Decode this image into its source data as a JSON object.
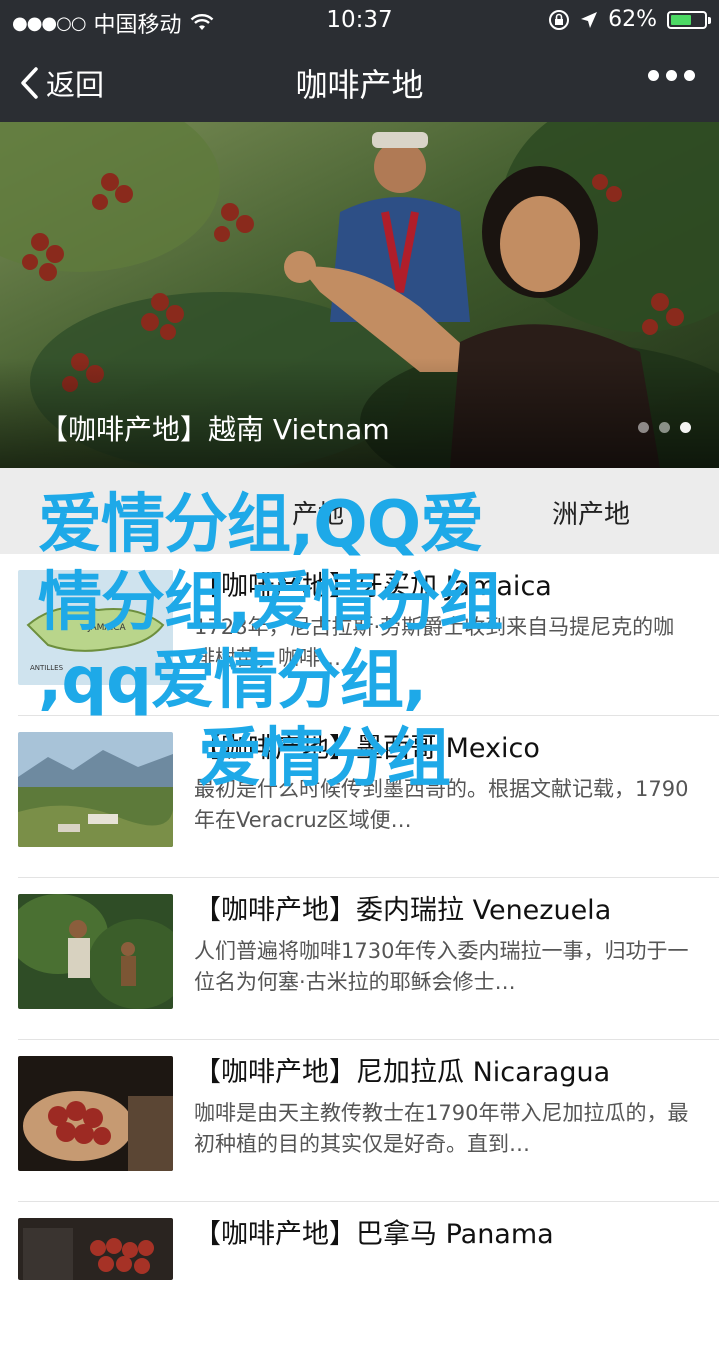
{
  "status_bar": {
    "carrier": "中国移动",
    "signal": "●●●○○",
    "time": "10:37",
    "battery": "62%",
    "battery_level": 0.62,
    "icons": [
      "wifi-icon",
      "lock-rotation-icon",
      "location-arrow-icon",
      "battery-icon"
    ]
  },
  "nav": {
    "back_label": "返回",
    "title": "咖啡产地"
  },
  "hero": {
    "caption": "【咖啡产地】越南 Vietnam",
    "slides": 3,
    "active_slide": 3
  },
  "partial_row": {
    "text_left": "产地",
    "text_right": "洲产地"
  },
  "items": [
    {
      "title": "【咖啡产地】牙买加 Jamaica",
      "desc": "1728年，尼古拉斯·劳斯爵士收到来自马提尼克的咖啡树苗，咖啡…",
      "thumb_label": "JAMAICA",
      "thumb_sub": "ANTILLES"
    },
    {
      "title": "【咖啡产地】墨西哥 Mexico",
      "desc": "最初是什么时候传到墨西哥的。根据文献记载，1790年在Veracruz区域便…"
    },
    {
      "title": "【咖啡产地】委内瑞拉 Venezuela",
      "desc": "人们普遍将咖啡1730年传入委内瑞拉一事，归功于一位名为何塞·古米拉的耶稣会修士…"
    },
    {
      "title": "【咖啡产地】尼加拉瓜 Nicaragua",
      "desc": "咖啡是由天主教传教士在1790年带入尼加拉瓜的，最初种植的目的其实仅是好奇。直到…"
    },
    {
      "title": "【咖啡产地】巴拿马 Panama",
      "desc": ""
    }
  ],
  "watermark": {
    "lines": [
      "爱情分组,QQ爱",
      "情分组,爱情分组",
      ",qq爱情分组,",
      "爱情分组"
    ],
    "color": "#1ea9e8"
  },
  "colors": {
    "topbar": "#2b2e33",
    "battery_fill": "#4cd964"
  }
}
